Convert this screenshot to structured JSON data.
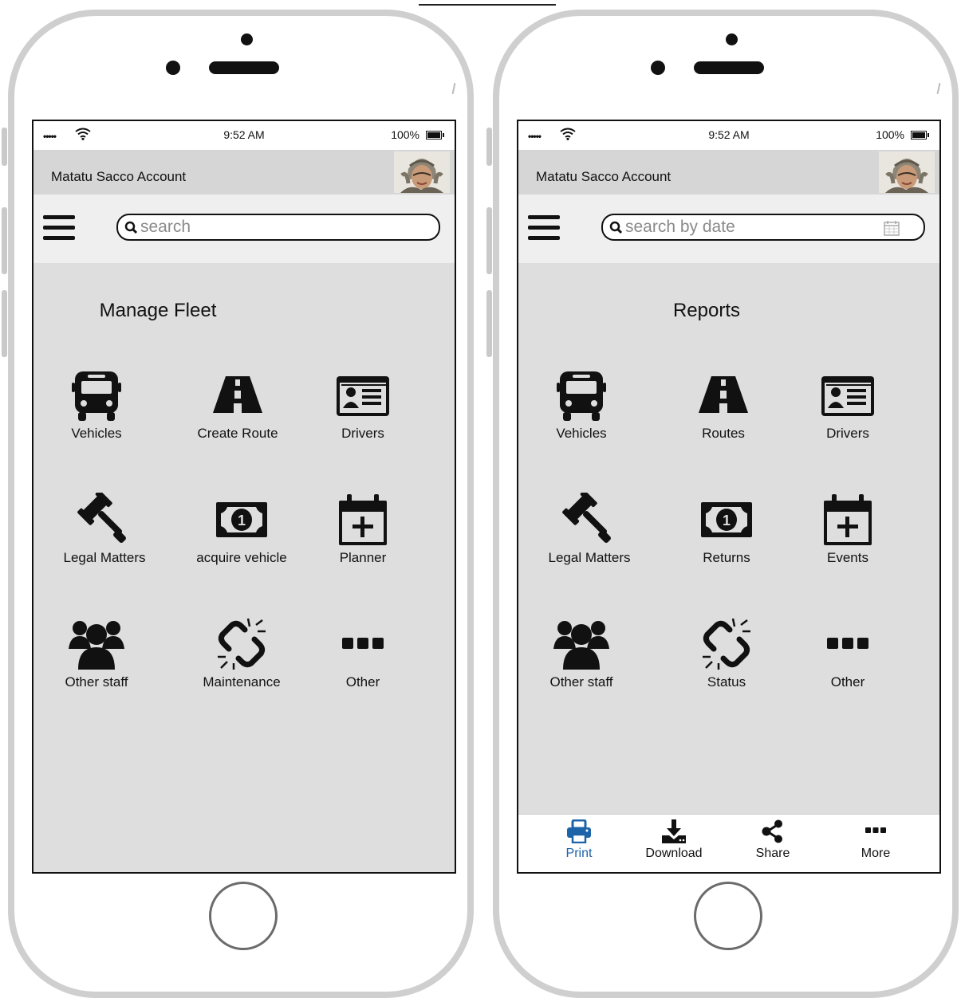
{
  "status_bar": {
    "signal": "•••••",
    "time": "9:52 AM",
    "battery": "100%"
  },
  "left_screen": {
    "account_title": "Matatu Sacco Account",
    "search_placeholder": "search",
    "page_title": "Manage Fleet",
    "tiles": [
      {
        "label": "Vehicles",
        "icon": "bus-icon"
      },
      {
        "label": "Create Route",
        "icon": "road-icon"
      },
      {
        "label": "Drivers",
        "icon": "id-card-icon"
      },
      {
        "label": "Legal Matters",
        "icon": "gavel-icon"
      },
      {
        "label": "acquire vehicle",
        "icon": "money-icon"
      },
      {
        "label": "Planner",
        "icon": "calendar-plus-icon"
      },
      {
        "label": "Other staff",
        "icon": "group-icon"
      },
      {
        "label": "Maintenance",
        "icon": "broken-link-icon"
      },
      {
        "label": "Other",
        "icon": "ellipsis-icon"
      }
    ]
  },
  "right_screen": {
    "account_title": "Matatu Sacco Account",
    "search_placeholder": "search by date",
    "page_title": "Reports",
    "tiles": [
      {
        "label": "Vehicles",
        "icon": "bus-icon"
      },
      {
        "label": "Routes",
        "icon": "road-icon"
      },
      {
        "label": "Drivers",
        "icon": "id-card-icon"
      },
      {
        "label": "Legal Matters",
        "icon": "gavel-icon"
      },
      {
        "label": "Returns",
        "icon": "money-icon"
      },
      {
        "label": "Events",
        "icon": "calendar-plus-icon"
      },
      {
        "label": "Other staff",
        "icon": "group-icon"
      },
      {
        "label": "Status",
        "icon": "broken-link-icon"
      },
      {
        "label": "Other",
        "icon": "ellipsis-icon"
      }
    ],
    "toolbar": [
      {
        "label": "Print",
        "icon": "print-icon",
        "active": true
      },
      {
        "label": "Download",
        "icon": "download-icon"
      },
      {
        "label": "Share",
        "icon": "share-icon"
      },
      {
        "label": "More",
        "icon": "ellipsis-icon"
      }
    ]
  },
  "colors": {
    "screen_bg": "#dedede",
    "account_bar": "#d6d6d6",
    "search_bar": "#efefef",
    "active_toolbar": "#1d63a8"
  }
}
